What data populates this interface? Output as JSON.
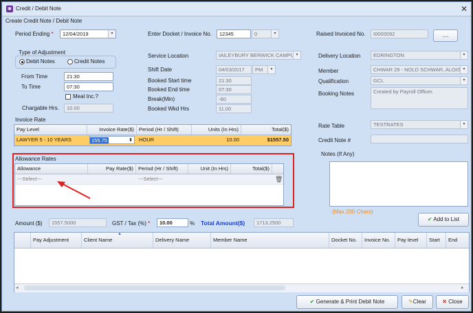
{
  "window": {
    "title": "Credit / Debit Note",
    "subtitle": "Create Credit Note / Debit Note"
  },
  "period_ending": {
    "label": "Period Ending",
    "value": "12/04/2019"
  },
  "docket": {
    "label": "Enter Docket / Invoice No.",
    "value": "12345",
    "second_value": "0"
  },
  "raised_invoiced": {
    "label": "Raised Invoiced No.",
    "value": "I0000092",
    "button": "...."
  },
  "adjustment": {
    "group_label": "Type of Adjustment",
    "debit": "Debit Notes",
    "credit": "Credit Notes"
  },
  "from_time": {
    "label": "From Time",
    "value": "21:30"
  },
  "to_time": {
    "label": "To Time",
    "value": "07:30"
  },
  "meal": {
    "label": "Meal Inc.?"
  },
  "chargable": {
    "label": "Chargable Hrs.",
    "value": "10.00"
  },
  "service_location": {
    "label": "Service Location",
    "value": "IAILEYBURY BERWICK CAMPUS"
  },
  "shift_date": {
    "label": "Shift Date",
    "value": "04/03/2017",
    "ampm": "PM"
  },
  "booked_start": {
    "label": "Booked Start time",
    "value": "21:30"
  },
  "booked_end": {
    "label": "Booked End time",
    "value": "07:30"
  },
  "break": {
    "label": "Break(Min)",
    "value": "-60"
  },
  "booked_wkd": {
    "label": "Booked Wkd Hrs",
    "value": "11.00"
  },
  "delivery_location": {
    "label": "Delivery Location",
    "value": "EDRINGTON"
  },
  "member": {
    "label": "Member",
    "value": "CHWAR 29 - NOLD SCHWAR, ALOIS"
  },
  "qualification": {
    "label": "Qualification",
    "value": "GCL"
  },
  "booking_notes": {
    "label": "Booking Notes",
    "value": "Created by Payroll Officer."
  },
  "invoice_rate": {
    "section_label": "Invoice Rate",
    "headers": [
      "Pay Level",
      "Invoice Rate($)",
      "Period (Hr / Shift)",
      "Units (In Hrs)",
      "Total($)"
    ],
    "row": {
      "pay_level": "LAWYER 5 - 10 YEARS",
      "rate": "155.75",
      "period": "HOUR",
      "units": "10.00",
      "total": "$1557.50"
    }
  },
  "rate_table": {
    "label": "Rate Table",
    "value": "TESTRATES"
  },
  "credit_note": {
    "label": "Credit Note #",
    "value": ""
  },
  "notes": {
    "label": "Notes (If Any)",
    "hint": "(Max 200  Chars)"
  },
  "allowance": {
    "section_label": "Allowance Rates",
    "headers": [
      "Allowance",
      "Pay Rate($)",
      "Period (Hr / Shift)",
      "Unit (In Hrs)",
      "Total($)"
    ],
    "row": {
      "allowance": "---Select---",
      "period": "---Select---"
    }
  },
  "amount": {
    "label": "Amount ($)",
    "value": "1557.5000"
  },
  "gst": {
    "label": "GST / Tax (%)",
    "value": "10.00",
    "unit": "%"
  },
  "total_amount": {
    "label": "Total Amount($)",
    "value": "1713.2500"
  },
  "add_to_list": "Add to List",
  "list_grid": {
    "headers": [
      "Pay Adjustment",
      "Client Name",
      "Delivery Name",
      "Member Name",
      "Docket No.",
      "Invoice No.",
      "Pay level",
      "Start",
      "End"
    ]
  },
  "buttons": {
    "generate": "Generate & Print Debit Note",
    "clear": "Clear",
    "close": "Close"
  },
  "colors": {
    "highlight_row": "#ffcc66",
    "annotation": "#e02020"
  }
}
